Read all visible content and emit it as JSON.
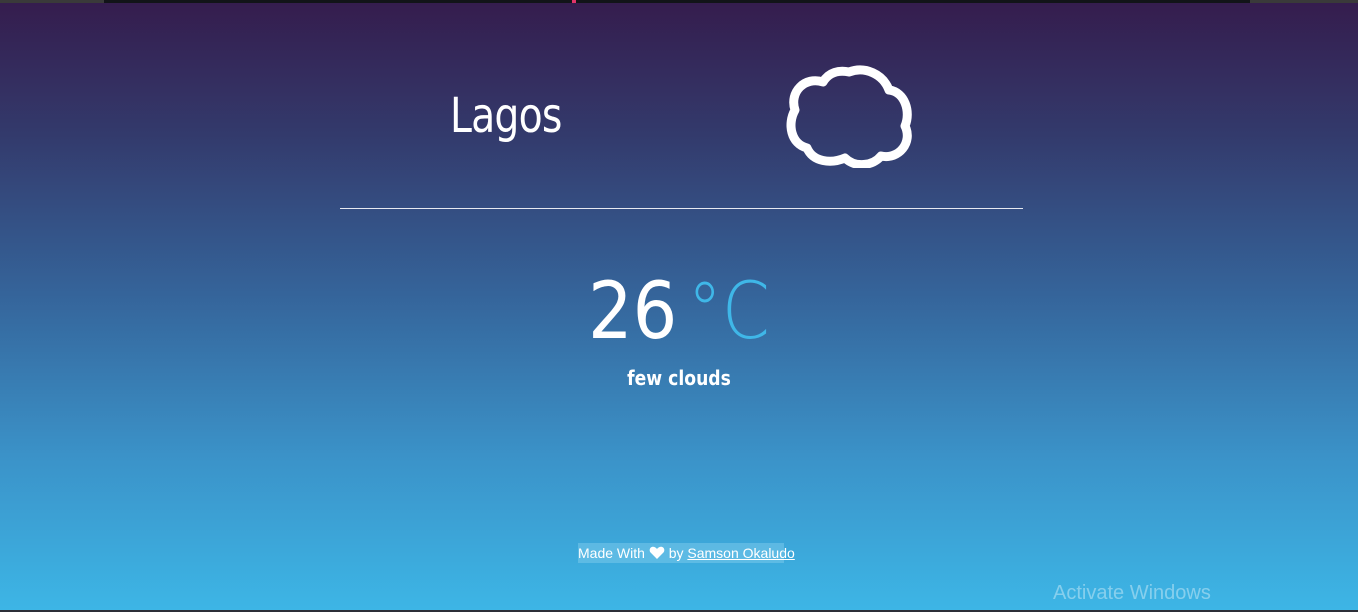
{
  "weather": {
    "city": "Lagos",
    "icon": "cloud-icon",
    "temperature": "26",
    "unit": "°C",
    "description": "few clouds"
  },
  "footer": {
    "made_with": "Made With",
    "by": "by",
    "author": "Samson Okaludo",
    "heart_icon": "heart-icon"
  },
  "watermark": {
    "title": "Activate Windows"
  },
  "colors": {
    "accent": "#3fb7e8",
    "gradient_top": "#351c4d",
    "gradient_bottom": "#3db6e6"
  }
}
